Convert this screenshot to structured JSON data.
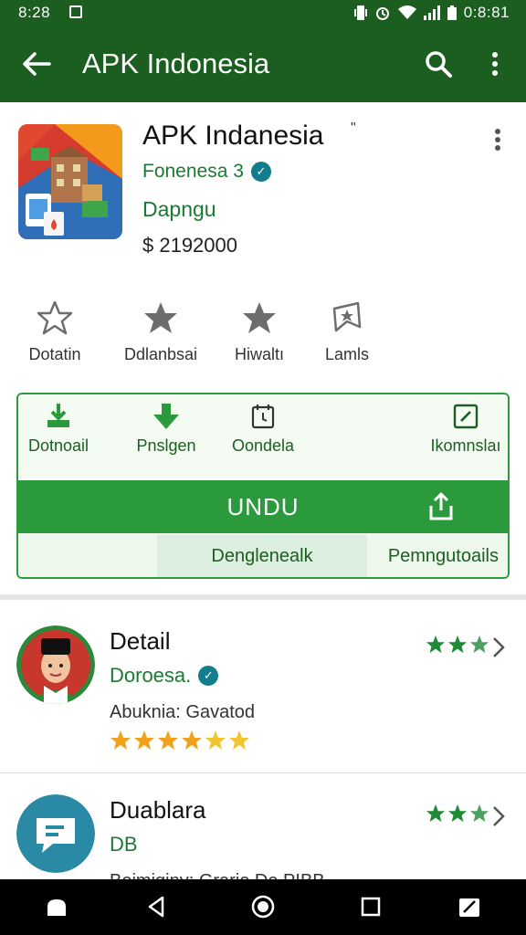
{
  "status_bar": {
    "time_left": "8:28",
    "time_right": "0:8:81"
  },
  "app_bar": {
    "title": "APK Indonesia"
  },
  "app": {
    "title": "APK Indanesia",
    "title_mark": "\"",
    "developer": "Fonenesa 3",
    "category": "Dapngu",
    "price": "$ 2192000"
  },
  "stats": [
    {
      "label": "Dotatin",
      "icon": "star-outline-icon"
    },
    {
      "label": "Ddlanbsai",
      "icon": "star-filled-icon"
    },
    {
      "label": "Hiwaltı",
      "icon": "star-filled-icon"
    },
    {
      "label": "Lamls",
      "icon": "bookmark-star-icon"
    }
  ],
  "quick_actions": [
    {
      "label": "Dotnoail",
      "icon": "download-icon"
    },
    {
      "label": "Pnslgen",
      "icon": "download-arrow-icon"
    },
    {
      "label": "Oondela",
      "icon": "calendar-icon"
    },
    {
      "label": "Ikomnslaı",
      "icon": "edit-icon"
    }
  ],
  "install": {
    "label": "UNDU",
    "icon": "share-icon"
  },
  "sub_actions": {
    "middle": "Denglenealk",
    "right": "Pemngutoails"
  },
  "list": [
    {
      "title": "Detail",
      "subtitle": "Doroesa.",
      "meta": "Abuknia: Gavatod",
      "stars": 5,
      "rating_stars": 3,
      "avatar_icon": "person-avatar-icon",
      "verified": true
    },
    {
      "title": "Duablara",
      "subtitle": "DB",
      "meta": "Boimiginy: Grarie De PIBB",
      "rating_stars": 3,
      "avatar_icon": "chat-bubble-icon"
    }
  ],
  "colors": {
    "primary_dark": "#1b5e20",
    "primary": "#2b9a3c",
    "accent_green_text": "#1b7a32",
    "star_grey": "#6d6d6d",
    "star_orange": "#f0a21b",
    "verified_teal": "#127d8f"
  }
}
